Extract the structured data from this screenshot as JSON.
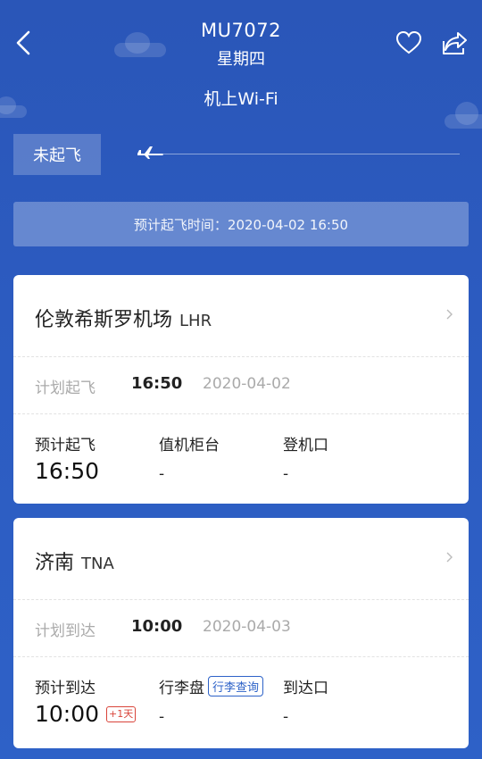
{
  "header": {
    "flight_no": "MU7072",
    "day": "星期四",
    "wifi": "机上Wi-Fi"
  },
  "status": {
    "label": "未起飞",
    "progress": 0
  },
  "estimate_bar": {
    "text": "预计起飞时间：2020-04-02 16:50"
  },
  "departure": {
    "airport_name": "伦敦希斯罗机场",
    "airport_code": "LHR",
    "sched_label": "计划起飞",
    "sched_time": "16:50",
    "sched_date": "2020-04-02",
    "est_label": "预计起飞",
    "est_time": "16:50",
    "counter_label": "值机柜台",
    "counter_value": "-",
    "gate_label": "登机口",
    "gate_value": "-"
  },
  "arrival": {
    "airport_name": "济南",
    "airport_code": "TNA",
    "sched_label": "计划到达",
    "sched_time": "10:00",
    "sched_date": "2020-04-03",
    "est_label": "预计到达",
    "est_time": "10:00",
    "plus_day": "+1天",
    "baggage_label": "行李盘",
    "baggage_button": "行李查询",
    "baggage_value": "-",
    "exit_label": "到达口",
    "exit_value": "-"
  },
  "colors": {
    "background": "#2c5bc0",
    "accent": "#2d62c8",
    "plus_day": "#d9443a"
  }
}
